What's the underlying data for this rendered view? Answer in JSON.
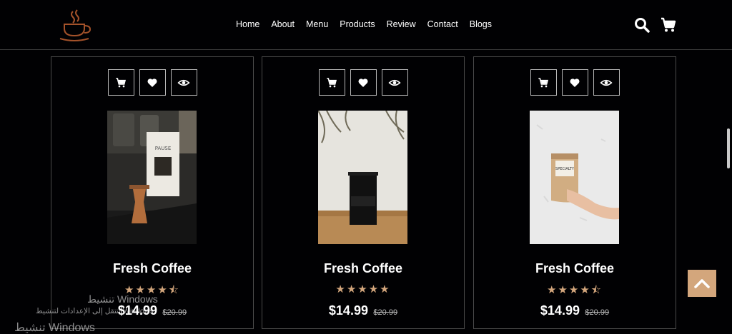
{
  "nav": {
    "items": [
      "Home",
      "About",
      "Menu",
      "Products",
      "Review",
      "Contact",
      "Blogs"
    ]
  },
  "header": {
    "search_icon": "search-icon",
    "cart_icon": "cart-icon"
  },
  "products": [
    {
      "name": "Fresh Coffee",
      "price": "$14.99",
      "old_price": "$20.99",
      "rating": 4.5,
      "stars": "★★★★⯪"
    },
    {
      "name": "Fresh Coffee",
      "price": "$14.99",
      "old_price": "$20.99",
      "rating": 5,
      "stars": "★★★★★"
    },
    {
      "name": "Fresh Coffee",
      "price": "$14.99",
      "old_price": "$20.99",
      "rating": 4.5,
      "stars": "★★★★⯪"
    }
  ],
  "watermark": {
    "line1": "تنشيط Windows",
    "line2": "انتقل إلى الإعدادات لتنشيط Windows.",
    "line3": "تنشيط Windows"
  },
  "colors": {
    "accent": "#d3a67c",
    "background": "#010103",
    "border": "#4a4a4a"
  }
}
